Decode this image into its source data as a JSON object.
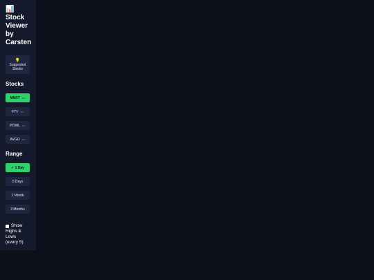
{
  "app": {
    "title_icon": "📊",
    "title_lines": [
      "Stock",
      "Viewer",
      "by",
      "Carsten"
    ]
  },
  "suggested": {
    "icon": "💡",
    "line1": "Suggested",
    "line2": "Stocks"
  },
  "stocks": {
    "heading": "Stocks",
    "items": [
      {
        "label": "MNST",
        "dots": "•••",
        "active": true
      },
      {
        "label": "FTV",
        "dots": "•••",
        "active": false
      },
      {
        "label": "POWL",
        "dots": "•••",
        "active": false
      },
      {
        "label": "AVGO",
        "dots": "•••",
        "active": false
      }
    ]
  },
  "range": {
    "heading": "Range",
    "items": [
      {
        "label": "✓ 1 Day",
        "active": true
      },
      {
        "label": "5 Days",
        "active": false
      },
      {
        "label": "1 Month",
        "active": false
      },
      {
        "label": "3 Months",
        "active": false
      }
    ]
  },
  "highs_lows": {
    "line1": "Show",
    "line2": "Highs &",
    "line3": "Lows",
    "line4": "(every 5)",
    "checked": false
  },
  "colors": {
    "background": "#0b101b",
    "sidebar": "#141a2b",
    "button": "#1f2640",
    "accent": "#2ed16a"
  }
}
